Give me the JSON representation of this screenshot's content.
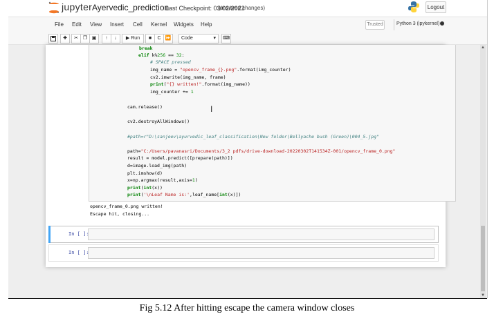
{
  "header": {
    "brand": "jupyter",
    "notebook_name": "Ayervedic_prediction",
    "checkpoint": "Last Checkpoint: 03/02/2022",
    "unsaved": "(unsaved changes)",
    "logout_label": "Logout"
  },
  "menu": {
    "items": [
      "File",
      "Edit",
      "View",
      "Insert",
      "Cell",
      "Kernel",
      "Widgets",
      "Help"
    ],
    "trusted_label": "Trusted",
    "kernel_label": "Python 3 (ipykernel)"
  },
  "toolbar": {
    "run_label": "Run",
    "cell_type": "Code"
  },
  "code_lines": [
    "break",
    "elif k%256 == 32:",
    "# SPACE pressed",
    "img_name = \"opencv_frame_{}.png\".format(img_counter)",
    "cv2.imwrite(img_name, frame)",
    "print(\"{} written!\".format(img_name))",
    "img_counter += 1",
    "cam.release()",
    "cv2.destroyAllWindows()",
    "#path=r\"D:\\sanjeev\\ayurvedic_leaf_classification\\New folder\\Bellyache bush (Green)\\004_5.jpg\"",
    "path=\"C:/Users/pavanasri/Documents/3_2 pdfs/drive-download-20220302T141534Z-001/opencv_frame_0.png\"",
    "result = model.predict([prepare(path)])",
    "d=image.load_img(path)",
    "plt.imshow(d)",
    "x=np.argmax(result,axis=1)",
    "print(int(x))",
    "print('\\nLeaf Name is:',leaf_name[int(x)])"
  ],
  "output_lines": [
    "opencv_frame_0.png written!",
    "Escape hit, closing..."
  ],
  "cells": [
    {
      "prompt": "In [ ]:"
    },
    {
      "prompt": "In [ ]:"
    }
  ],
  "caption": "Fig 5.12 After hitting escape the camera window closes"
}
